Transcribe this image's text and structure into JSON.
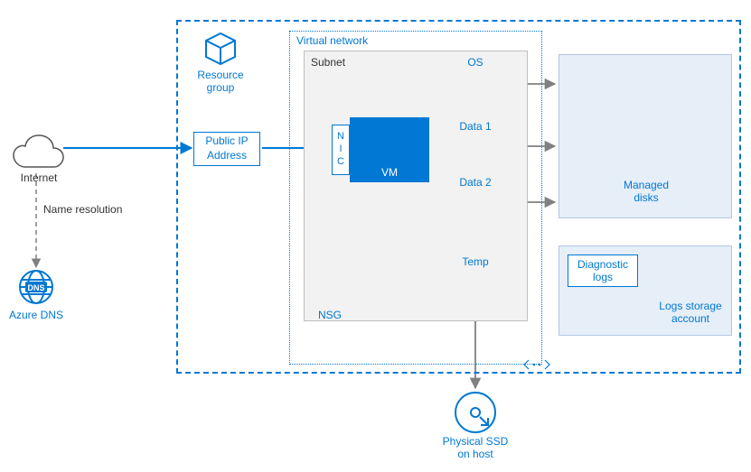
{
  "internet_label": "Internet",
  "name_resolution_label": "Name resolution",
  "azure_dns_label": "Azure DNS",
  "resource_group_label": "Resource\ngroup",
  "public_ip_label": "Public IP\nAddress",
  "vnet_label": "Virtual network",
  "subnet_label": "Subnet",
  "nic_label": "NIC",
  "vm_label": "VM",
  "nsg_label": "NSG",
  "disks": {
    "os": "OS",
    "data1": "Data 1",
    "data2": "Data 2",
    "temp": "Temp"
  },
  "managed_disks_label": "Managed\ndisks",
  "diagnostic_logs_label": "Diagnostic\nlogs",
  "logs_storage_label": "Logs storage\naccount",
  "physical_ssd_label": "Physical SSD\non host",
  "colors": {
    "azure": "#0078d4",
    "panel": "#e6eef8",
    "subnet": "#f2f2f2",
    "dark": "#333333"
  }
}
